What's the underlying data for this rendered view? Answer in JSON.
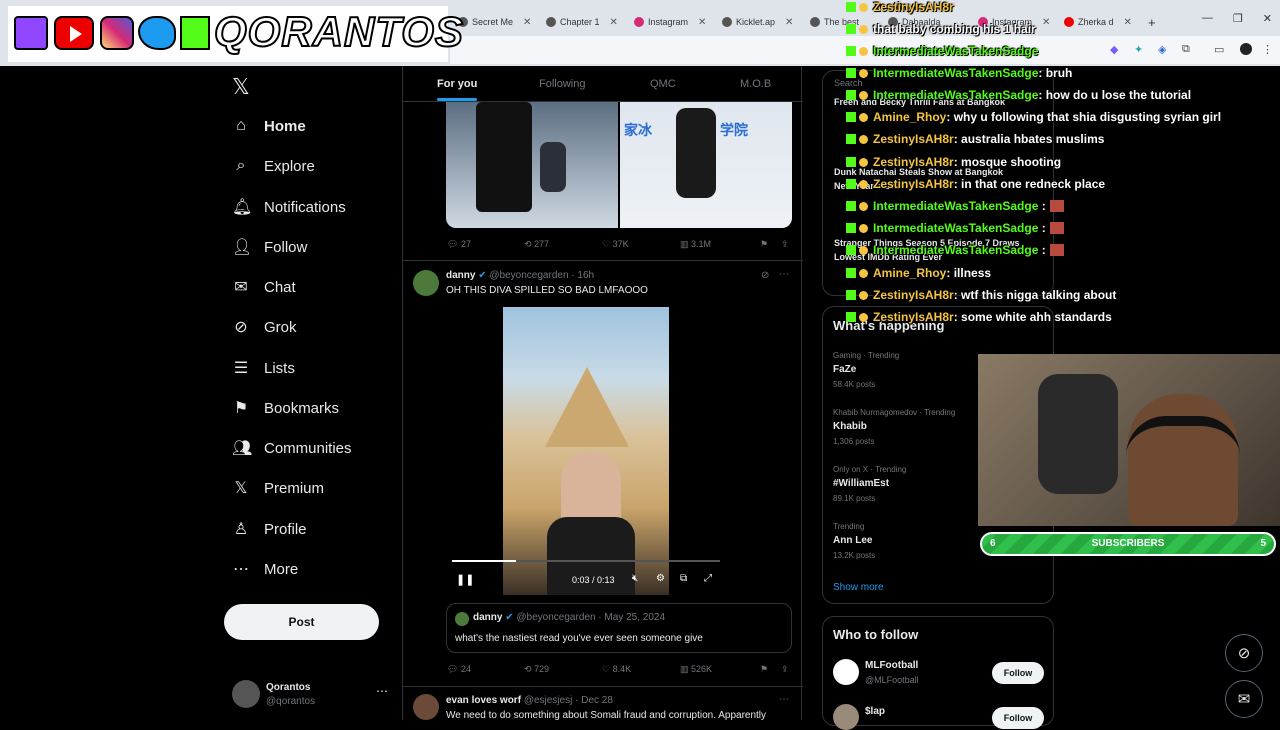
{
  "streamer_banner": {
    "name": "QORANTOS"
  },
  "browser": {
    "tabs": [
      {
        "label": "Secret Me"
      },
      {
        "label": "Chapter 1"
      },
      {
        "label": "Instagram"
      },
      {
        "label": "Kicklet.ap"
      },
      {
        "label": "The best"
      },
      {
        "label": "Dabaalda"
      },
      {
        "label": "Instagram"
      },
      {
        "label": "Zherka d"
      }
    ]
  },
  "nav": {
    "items": [
      {
        "label": "Home",
        "icon": "home-icon"
      },
      {
        "label": "Explore",
        "icon": "search-icon"
      },
      {
        "label": "Notifications",
        "icon": "bell-icon"
      },
      {
        "label": "Follow",
        "icon": "follow-icon"
      },
      {
        "label": "Chat",
        "icon": "mail-icon"
      },
      {
        "label": "Grok",
        "icon": "grok-icon"
      },
      {
        "label": "Lists",
        "icon": "list-icon"
      },
      {
        "label": "Bookmarks",
        "icon": "bookmark-icon"
      },
      {
        "label": "Communities",
        "icon": "communities-icon"
      },
      {
        "label": "Premium",
        "icon": "x-icon"
      },
      {
        "label": "Profile",
        "icon": "profile-icon"
      },
      {
        "label": "More",
        "icon": "more-icon"
      }
    ],
    "post_label": "Post",
    "account": {
      "name": "Qorantos",
      "handle": "@qorantos"
    }
  },
  "feed": {
    "tabs": [
      "For you",
      "Following",
      "QMC",
      "M.O.B"
    ],
    "tweet0_stats": {
      "replies": "27",
      "retweets": "277",
      "likes": "37K",
      "views": "3.1M"
    },
    "media0_text": "家冰",
    "media0_text2": "学院",
    "tweet1": {
      "name": "danny",
      "handle": "@beyoncegarden",
      "time": "· 16h",
      "text": "OH THIS DIVA SPILLED SO BAD LMFAOOO",
      "video_time": "0:03 / 0:13",
      "quote": {
        "name": "danny",
        "handle": "@beyoncegarden",
        "date": "· May 25, 2024",
        "text": "what's the nastiest read you've ever seen someone give"
      },
      "stats": {
        "replies": "24",
        "retweets": "729",
        "likes": "8.4K",
        "views": "526K"
      }
    },
    "tweet2": {
      "name": "evan loves worf",
      "handle": "@esjesjesj",
      "time": "· Dec 28",
      "text": "We need to do something about Somali fraud and corruption. Apparently"
    }
  },
  "right": {
    "search_placeholder": "Search",
    "news": [
      {
        "text": "Freen and Becky Thrill Fans at Bangkok"
      },
      {
        "text": "Dunk Natachai Steals Show at Bangkok"
      },
      {
        "text": "New Year's Eve"
      },
      {
        "text": "Stranger Things Season 5 Episode 7 Draws"
      },
      {
        "text": "Lowest IMDb Rating Ever"
      }
    ],
    "whats_happening": "What's happening",
    "trends": [
      {
        "meta": "Gaming · Trending",
        "name": "FaZe",
        "posts": "58.4K posts"
      },
      {
        "meta": "Khabib Nurmagomedov · Trending",
        "name": "Khabib",
        "posts": "1,306 posts"
      },
      {
        "meta": "Only on X · Trending",
        "name": "#WilliamEst",
        "posts": "89.1K posts"
      },
      {
        "meta": "Trending",
        "name": "Ann Lee",
        "posts": "13.2K posts"
      }
    ],
    "show_more": "Show more",
    "who_to_follow": "Who to follow",
    "follow": [
      {
        "name": "MLFootball",
        "handle": "@MLFootball",
        "button": "Follow"
      },
      {
        "name": "$lap",
        "handle": "",
        "button": "Follow"
      }
    ]
  },
  "chat": [
    {
      "user": "ZestinyIsAH8r",
      "color": "yellow",
      "msg": ""
    },
    {
      "user": "",
      "color": "yellow",
      "msg": "that baby combing his 1 hair"
    },
    {
      "user": "IntermediateWasTakenSadge",
      "color": "green",
      "msg": ""
    },
    {
      "user": "IntermediateWasTakenSadge",
      "color": "green",
      "msg": ": bruh"
    },
    {
      "user": "IntermediateWasTakenSadge",
      "color": "green",
      "msg": ": how do u lose the tutorial"
    },
    {
      "user": "Amine_Rhoy",
      "color": "yellow",
      "msg": ": why u following that shia disgusting syrian girl"
    },
    {
      "user": "ZestinyIsAH8r",
      "color": "yellow",
      "msg": ": australia hbates muslims"
    },
    {
      "user": "ZestinyIsAH8r",
      "color": "yellow",
      "msg": ": mosque shooting"
    },
    {
      "user": "ZestinyIsAH8r",
      "color": "yellow",
      "msg": ": in that one redneck place"
    },
    {
      "user": "IntermediateWasTakenSadge",
      "color": "green",
      "msg": " :"
    },
    {
      "user": "IntermediateWasTakenSadge",
      "color": "green",
      "msg": " :"
    },
    {
      "user": "IntermediateWasTakenSadge",
      "color": "green",
      "msg": " :"
    },
    {
      "user": "Amine_Rhoy",
      "color": "yellow",
      "msg": ": illness"
    },
    {
      "user": "ZestinyIsAH8r",
      "color": "yellow",
      "msg": ": wtf this nigga talking about"
    },
    {
      "user": "ZestinyIsAH8r",
      "color": "yellow",
      "msg": ": some white ahh standards"
    }
  ],
  "subs": {
    "label": "SUBSCRIBERS",
    "left": "6",
    "right": "5"
  }
}
